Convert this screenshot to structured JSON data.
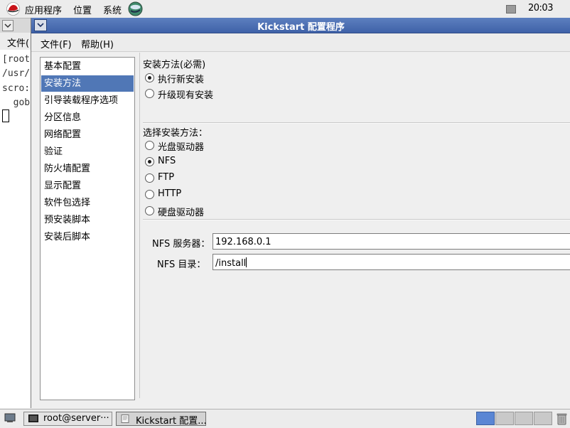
{
  "top_panel": {
    "menus": [
      "应用程序",
      "位置",
      "系统"
    ],
    "clock": "20:03"
  },
  "terminal": {
    "menu_file": "文件(",
    "lines": [
      "[root",
      "/usr/",
      "scro:",
      "  gob"
    ]
  },
  "kickstart": {
    "title": "Kickstart 配置程序",
    "menus": [
      "文件(F)",
      "帮助(H)"
    ],
    "nav_items": [
      "基本配置",
      "安装方法",
      "引导装载程序选项",
      "分区信息",
      "网络配置",
      "验证",
      "防火墙配置",
      "显示配置",
      "软件包选择",
      "预安装脚本",
      "安装后脚本"
    ],
    "nav_selected_index": 1,
    "install_section_label": "安装方法(必需)",
    "install_options": [
      "执行新安装",
      "升级现有安装"
    ],
    "install_selected_index": 0,
    "method_label": "选择安装方法：",
    "method_options": [
      "光盘驱动器",
      "NFS",
      "FTP",
      "HTTP",
      "硬盘驱动器"
    ],
    "method_selected_index": 1,
    "nfs_server_label": "NFS 服务器：",
    "nfs_server_value": "192.168.0.1",
    "nfs_dir_label": "NFS 目录：",
    "nfs_dir_value": "/install"
  },
  "taskbar": {
    "tasks": [
      "root@server···",
      "Kickstart 配置..."
    ],
    "active_task_index": 1,
    "active_workspace_index": 0
  },
  "colors": {
    "title_bar": "#4a6db3",
    "selection": "#5077b6",
    "active_workspace": "#5a86d4"
  }
}
